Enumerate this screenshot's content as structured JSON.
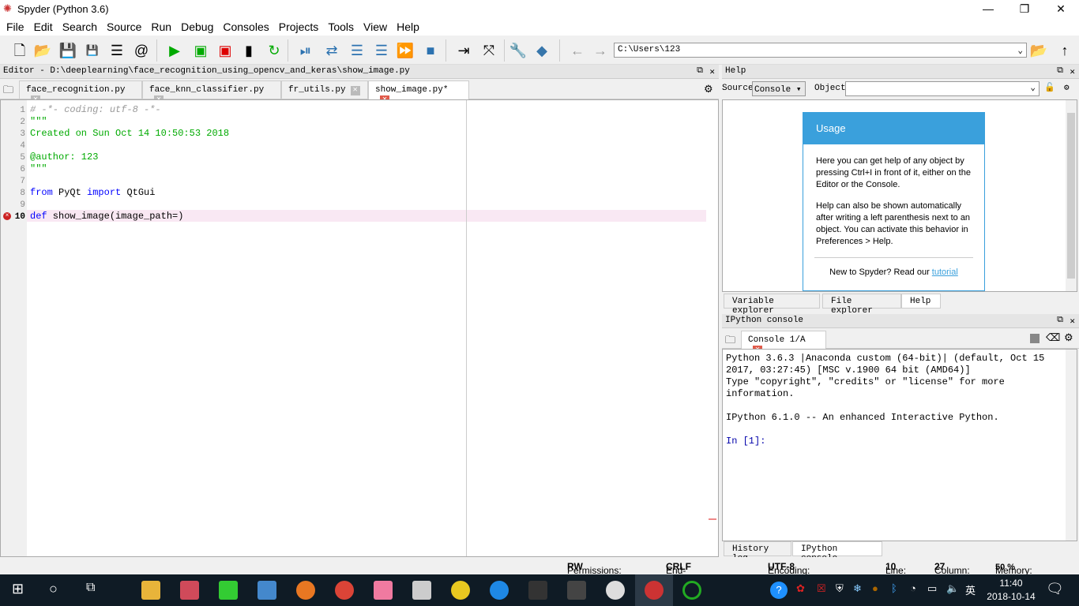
{
  "window": {
    "title": "Spyder (Python 3.6)"
  },
  "menu": [
    "File",
    "Edit",
    "Search",
    "Source",
    "Run",
    "Debug",
    "Consoles",
    "Projects",
    "Tools",
    "View",
    "Help"
  ],
  "toolbar": {
    "path": "C:\\Users\\123"
  },
  "editor": {
    "header": "Editor - D:\\deeplearning\\face_recognition_using_opencv_and_keras\\show_image.py",
    "tabs": [
      {
        "label": "face_recognition.py"
      },
      {
        "label": "face_knn_classifier.py"
      },
      {
        "label": "fr_utils.py"
      },
      {
        "label": "show_image.py*",
        "active": true
      }
    ],
    "lines": [
      "# -*- coding: utf-8 -*-",
      "\"\"\"",
      "Created on Sun Oct 14 10:50:53 2018",
      "",
      "@author: 123",
      "\"\"\"",
      "",
      "from PyQt import QtGui",
      "",
      "def show_image(image_path=)"
    ],
    "error_line": 10
  },
  "help": {
    "header": "Help",
    "source_label": "Source",
    "source_value": "Console",
    "object_label": "Object",
    "usage_title": "Usage",
    "p1": "Here you can get help of any object by pressing Ctrl+I in front of it, either on the Editor or the Console.",
    "p2": "Help can also be shown automatically after writing a left parenthesis next to an object. You can activate this behavior in Preferences > Help.",
    "new_prefix": "New to Spyder? Read our ",
    "tutorial": "tutorial",
    "tabs": [
      "Variable explorer",
      "File explorer",
      "Help"
    ]
  },
  "console": {
    "header": "IPython console",
    "tab": "Console 1/A",
    "lines": [
      "Python 3.6.3 |Anaconda custom (64-bit)| (default, Oct 15",
      "2017, 03:27:45) [MSC v.1900 64 bit (AMD64)]",
      "Type \"copyright\", \"credits\" or \"license\" for more",
      "information.",
      "",
      "IPython 6.1.0 -- An enhanced Interactive Python.",
      "",
      "In [1]:"
    ],
    "tabs": [
      "History log",
      "IPython console"
    ]
  },
  "status": {
    "permissions_label": "Permissions:",
    "permissions": "RW",
    "eol_label": "End-of-lines:",
    "eol": "CRLF",
    "encoding_label": "Encoding:",
    "encoding": "UTF-8",
    "line_label": "Line:",
    "line": "10",
    "column_label": "Column:",
    "column": "27",
    "memory_label": "Memory:",
    "memory": "50 %"
  },
  "taskbar": {
    "time": "11:40",
    "date": "2018-10-14",
    "ime": "英"
  }
}
